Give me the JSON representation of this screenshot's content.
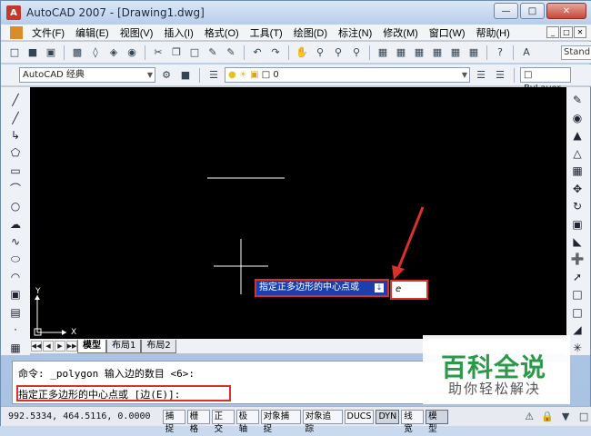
{
  "window": {
    "title": "AutoCAD 2007 - [Drawing1.dwg]"
  },
  "menu": [
    {
      "label": "文件(F)"
    },
    {
      "label": "编辑(E)"
    },
    {
      "label": "视图(V)"
    },
    {
      "label": "插入(I)"
    },
    {
      "label": "格式(O)"
    },
    {
      "label": "工具(T)"
    },
    {
      "label": "绘图(D)"
    },
    {
      "label": "标注(N)"
    },
    {
      "label": "修改(M)"
    },
    {
      "label": "窗口(W)"
    },
    {
      "label": "帮助(H)"
    }
  ],
  "toolbar1": {
    "text_style": "Stand"
  },
  "toolbar2": {
    "workspace": "AutoCAD 经典",
    "layer": "0",
    "linetype": "ByLayer"
  },
  "tabs": [
    {
      "label": "模型"
    },
    {
      "label": "布局1"
    },
    {
      "label": "布局2"
    }
  ],
  "canvas": {
    "axis_y": "Y",
    "axis_x": "X"
  },
  "dynamic_input": {
    "prompt": "指定正多边形的中心点或",
    "value": "e"
  },
  "command": {
    "line1": "命令: _polygon 输入边的数目 <6>:",
    "line2": "指定正多边形的中心点或 [边(E)]:"
  },
  "status": {
    "coords": "992.5334,  464.5116, 0.0000",
    "buttons": [
      {
        "label": "捕捉"
      },
      {
        "label": "栅格"
      },
      {
        "label": "正交"
      },
      {
        "label": "极轴"
      },
      {
        "label": "对象捕捉"
      },
      {
        "label": "对象追踪"
      },
      {
        "label": "DUCS"
      },
      {
        "label": "DYN"
      },
      {
        "label": "线宽"
      },
      {
        "label": "模型"
      }
    ]
  },
  "watermark": {
    "title": "百科全说",
    "subtitle": "助你轻松解决"
  },
  "colors": {
    "canvas": "#000000",
    "highlight": "#d8312a",
    "dyn_bg": "#1d3fae",
    "watermark": "#2a9a48"
  }
}
